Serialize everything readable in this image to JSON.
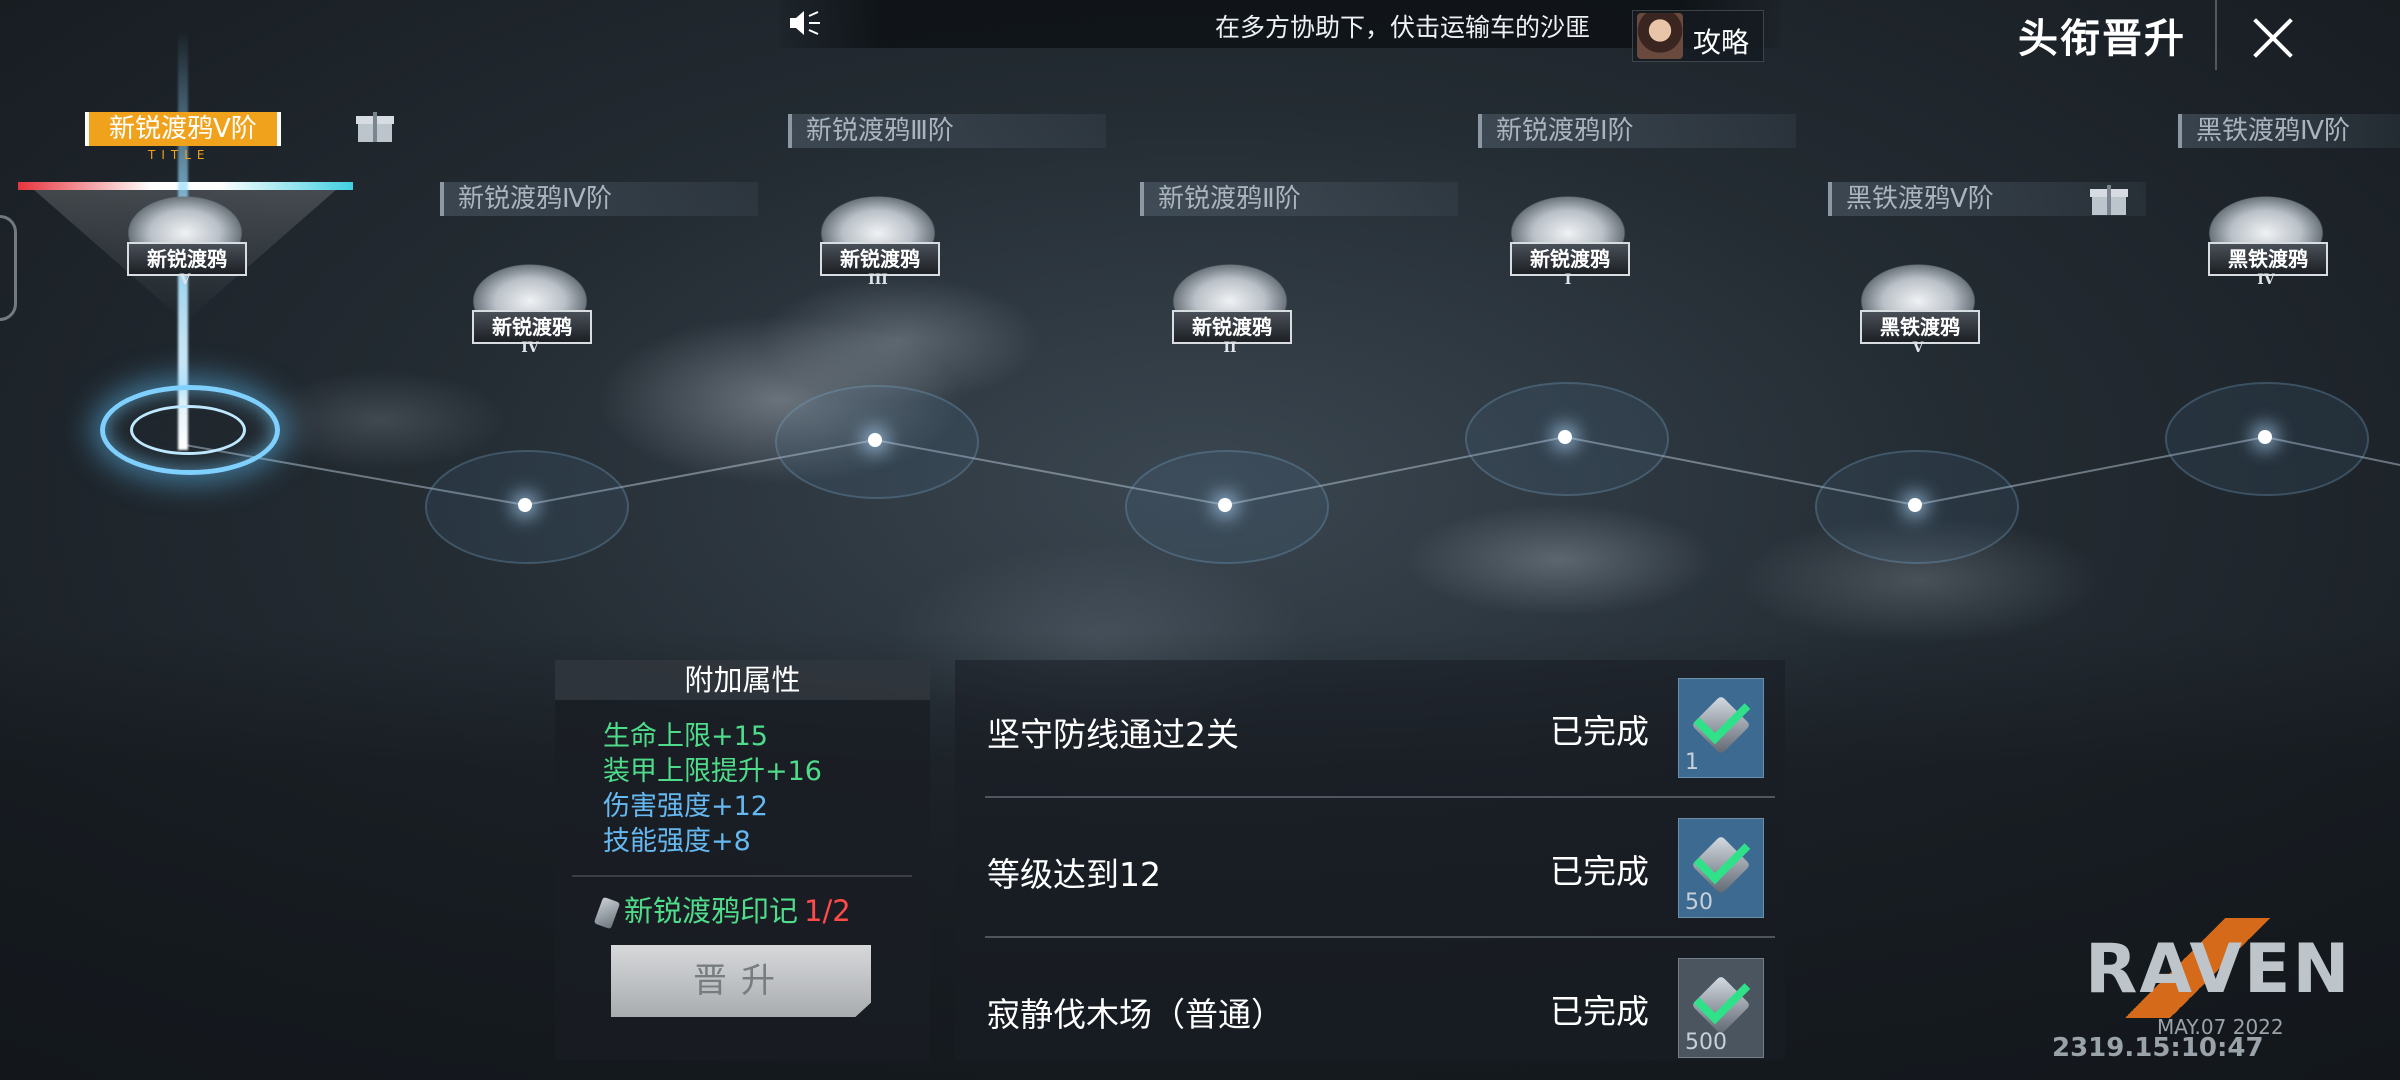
{
  "announcement": {
    "text": "在多方协助下，伏击运输车的沙匪"
  },
  "guide_button": {
    "label": "攻略"
  },
  "screen_title": "头衔晋升",
  "ranks": [
    {
      "label": "新锐渡鸦Ⅴ阶",
      "badge": "新锐渡鸦",
      "tier": "V",
      "current": true,
      "sub": "TITLE"
    },
    {
      "label": "新锐渡鸦Ⅳ阶",
      "badge": "新锐渡鸦",
      "tier": "IV"
    },
    {
      "label": "新锐渡鸦Ⅲ阶",
      "badge": "新锐渡鸦",
      "tier": "III"
    },
    {
      "label": "新锐渡鸦Ⅱ阶",
      "badge": "新锐渡鸦",
      "tier": "II"
    },
    {
      "label": "新锐渡鸦Ⅰ阶",
      "badge": "新锐渡鸦",
      "tier": "I"
    },
    {
      "label": "黑铁渡鸦Ⅴ阶",
      "badge": "黑铁渡鸦",
      "tier": "V"
    },
    {
      "label": "黑铁渡鸦Ⅳ阶",
      "badge": "黑铁渡鸦",
      "tier": "IV"
    }
  ],
  "attributes": {
    "title": "附加属性",
    "lines": [
      {
        "text": "生命上限+15",
        "color": "#4fdc8a"
      },
      {
        "text": "装甲上限提升+16",
        "color": "#4fdc8a"
      },
      {
        "text": "伤害强度+12",
        "color": "#66b8f0"
      },
      {
        "text": "技能强度+8",
        "color": "#66b8f0"
      }
    ],
    "mark_label": "新锐渡鸦印记",
    "mark_count": "1/2",
    "promote_label": "晋升"
  },
  "tasks": [
    {
      "name": "坚守防线通过2关",
      "status": "已完成",
      "reward_qty": "1"
    },
    {
      "name": "等级达到12",
      "status": "已完成",
      "reward_qty": "50"
    },
    {
      "name": "寂静伐木场（普通）",
      "status": "已完成",
      "reward_qty": "500"
    }
  ],
  "watermark": {
    "logo": "RAVEN",
    "date": "MAY.07 2022",
    "stamp": "2319.15:10:47"
  }
}
